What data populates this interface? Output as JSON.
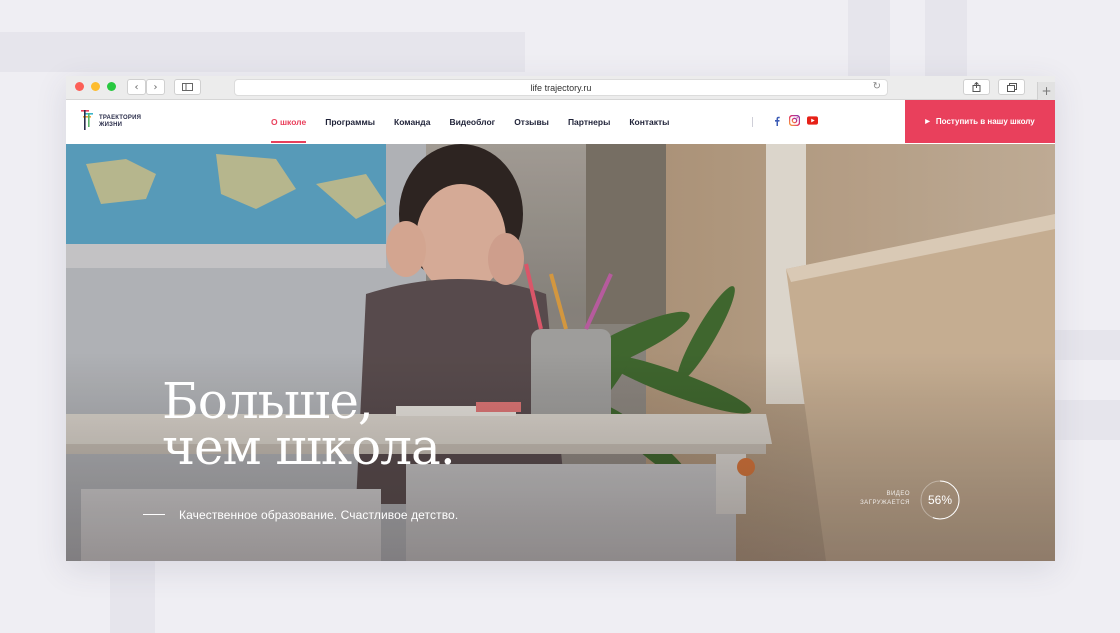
{
  "browser": {
    "url": "life trajectory.ru",
    "nav_back_icon": "chevron-left-icon",
    "nav_forward_icon": "chevron-right-icon",
    "sidebar_icon": "sidebar-icon",
    "reload_icon": "reload-icon",
    "share_icon": "share-icon",
    "tabs_icon": "tabs-icon",
    "new_tab_icon": "plus-icon"
  },
  "site": {
    "logo": {
      "line1": "ТРАЕКТОРИЯ",
      "line2": "ЖИЗНИ"
    },
    "nav": [
      {
        "label": "О школе",
        "active": true
      },
      {
        "label": "Программы",
        "active": false
      },
      {
        "label": "Команда",
        "active": false
      },
      {
        "label": "Видеоблог",
        "active": false
      },
      {
        "label": "Отзывы",
        "active": false
      },
      {
        "label": "Партнеры",
        "active": false
      },
      {
        "label": "Контакты",
        "active": false
      }
    ],
    "social": [
      "facebook-icon",
      "instagram-icon",
      "youtube-icon"
    ],
    "cta_label": "Поступить в нашу школу",
    "accent_color": "#e9405c"
  },
  "hero": {
    "headline_line1": "Больше,",
    "headline_line2": "чем школа.",
    "tagline": "Качественное образование.  Счастливое детство.",
    "loading_label_1": "ВИДЕО",
    "loading_label_2": "ЗАГРУЖАЕТСЯ",
    "progress_text": "56%",
    "progress_value": 56
  }
}
